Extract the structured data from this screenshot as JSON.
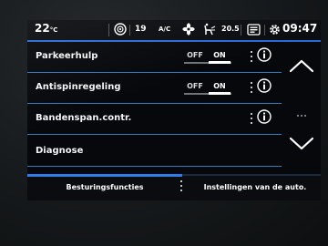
{
  "status_bar": {
    "temperature": "22",
    "temperature_unit": "°C",
    "nav_icon": "navigation-target-icon",
    "fan_level": "19",
    "ac_label": "A/C",
    "fan_icon": "fan-icon",
    "airflow_icon": "seat-airflow-icon",
    "right_temperature": "20.5",
    "screen_icon": "screen-mode-icon",
    "clock_icon": "settings-gear-icon",
    "time": "09:47"
  },
  "rows": [
    {
      "label": "Parkeerhulp",
      "toggle": {
        "off": "OFF",
        "on": "ON",
        "selected": "ON"
      }
    },
    {
      "label": "Antispinregeling",
      "toggle": {
        "off": "OFF",
        "on": "ON",
        "selected": "ON"
      }
    },
    {
      "label": "Bandenspan.contr."
    },
    {
      "label": "Diagnose"
    }
  ],
  "scroll": {
    "up_icon": "chevron-up-icon",
    "more_icon": "ellipsis-icon",
    "down_icon": "chevron-down-icon"
  },
  "tabs": [
    {
      "label": "Besturingsfuncties",
      "active": true
    },
    {
      "label": "Instellingen van de auto.",
      "active": false
    }
  ],
  "colors": {
    "accent": "#2f7ce8",
    "divider": "#3a8fe0",
    "background": "#06080b",
    "text": "#ffffff"
  }
}
